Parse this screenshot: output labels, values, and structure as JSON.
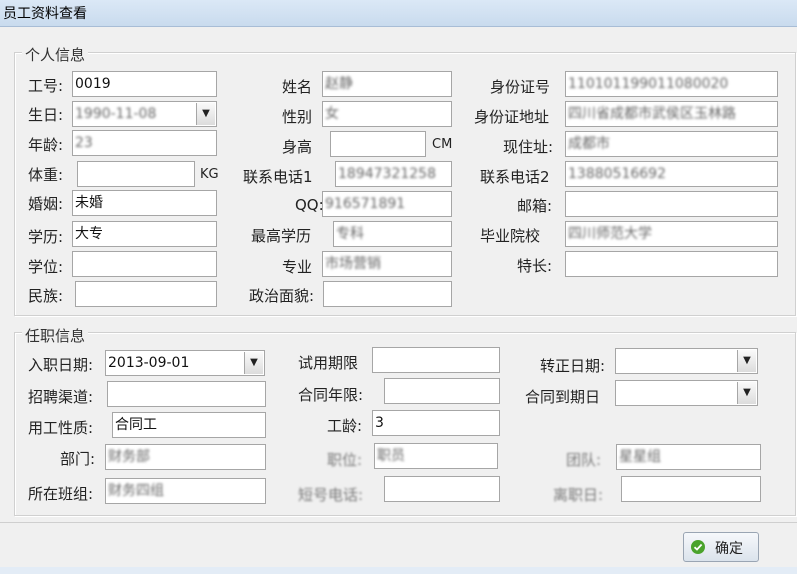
{
  "window": {
    "title": "员工资料查看"
  },
  "personal": {
    "legend": "个人信息",
    "emp_no": {
      "label": "工号:",
      "value": "0019"
    },
    "birth": {
      "label": "生日:",
      "value": "1990-11-08"
    },
    "age": {
      "label": "年龄:",
      "value": "23"
    },
    "weight": {
      "label": "体重:",
      "value": "",
      "unit": "KG"
    },
    "marital": {
      "label": "婚姻:",
      "value": "未婚"
    },
    "edu": {
      "label": "学历:",
      "value": "大专"
    },
    "degree": {
      "label": "学位:",
      "value": ""
    },
    "ethnic": {
      "label": "民族:",
      "value": ""
    },
    "name": {
      "label": "姓名",
      "value": "赵静"
    },
    "gender": {
      "label": "性别",
      "value": "女"
    },
    "height": {
      "label": "身高",
      "value": "",
      "unit": "CM"
    },
    "phone1": {
      "label": "联系电话1",
      "value": "18947321258"
    },
    "qq": {
      "label": "QQ:",
      "value": "916571891"
    },
    "top_edu": {
      "label": "最高学历",
      "value": "专科"
    },
    "major": {
      "label": "专业",
      "value": "市场营销"
    },
    "political": {
      "label": "政治面貌:",
      "value": ""
    },
    "id_no": {
      "label": "身份证号",
      "value": "110101199011080020"
    },
    "id_addr": {
      "label": "身份证地址",
      "value": "四川省成都市武侯区玉林路"
    },
    "address": {
      "label": "现住址:",
      "value": "成都市"
    },
    "phone2": {
      "label": "联系电话2",
      "value": "13880516692"
    },
    "email": {
      "label": "邮箱:",
      "value": ""
    },
    "school": {
      "label": "毕业院校",
      "value": "四川师范大学"
    },
    "specialty": {
      "label": "特长:",
      "value": ""
    }
  },
  "job": {
    "legend": "任职信息",
    "hire_date": {
      "label": "入职日期:",
      "value": "2013-09-01"
    },
    "channel": {
      "label": "招聘渠道:",
      "value": ""
    },
    "nature": {
      "label": "用工性质:",
      "value": "合同工"
    },
    "dept": {
      "label": "部门:",
      "value": "财务部"
    },
    "team": {
      "label": "所在班组:",
      "value": "财务四组"
    },
    "trial": {
      "label": "试用期限",
      "value": ""
    },
    "contract_years": {
      "label": "合同年限:",
      "value": ""
    },
    "seniority": {
      "label": "工龄:",
      "value": "3"
    },
    "position": {
      "label": "职位:",
      "value": "职员"
    },
    "short_phone": {
      "label": "短号电话:",
      "value": ""
    },
    "regular_date": {
      "label": "转正日期:",
      "value": ""
    },
    "contract_end": {
      "label": "合同到期日",
      "value": ""
    },
    "group": {
      "label": "团队:",
      "value": "星星组"
    },
    "resign_date": {
      "label": "离职日:",
      "value": ""
    }
  },
  "buttons": {
    "ok": "确定"
  },
  "icons": {
    "ok": "check-circle-icon",
    "dropdown": "chevron-down-icon"
  }
}
